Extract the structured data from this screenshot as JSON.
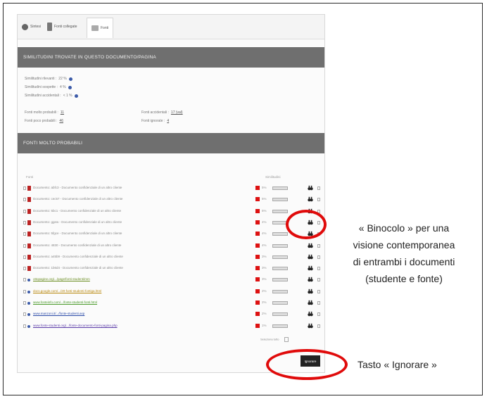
{
  "tabs": [
    {
      "label": "Sintesi",
      "icon": "globe-icon"
    },
    {
      "label": "Fonti collegate",
      "icon": "person-icon"
    },
    {
      "label": "Fonti",
      "icon": "document-icon"
    }
  ],
  "section_similarities": {
    "title": "SIMILITUDINI TROVATE IN QUESTO DOCUMENTO/PAGINA",
    "stats": [
      {
        "label": "Similitudini rilevanti :",
        "value": "22 %"
      },
      {
        "label": "Similitudini sospette :",
        "value": "4 %"
      },
      {
        "label": "Similitudini accidentali :",
        "value": "< 1 %"
      }
    ],
    "counts_left": [
      {
        "label": "Fonti molto probabili :",
        "value": "11"
      },
      {
        "label": "Fonti poco probabili :",
        "value": "46"
      }
    ],
    "counts_right": [
      {
        "label": "Fonti accidentali :",
        "value": "17 (val)"
      },
      {
        "label": "Fonti ignorate :",
        "value": "4"
      }
    ]
  },
  "section_sources": {
    "title": "FONTI MOLTO PROBABILI",
    "col_source": "Fonti",
    "col_similarity": "Similitudini",
    "rows": [
      {
        "n": "1",
        "text": "Documento: abfc3 - Documento confidenziale di un altro cliente",
        "pct": "5%",
        "web": false
      },
      {
        "n": "2",
        "text": "Documento: cec57 - Documento confidenziale di un altro cliente",
        "pct": "5%",
        "web": false
      },
      {
        "n": "3",
        "text": "Documento: 5bc1 - Documento confidenziale di un altro cliente",
        "pct": "5%",
        "web": false
      },
      {
        "n": "4",
        "text": "Documento: ggew - Documento confidenziale di un altro cliente",
        "pct": "4%",
        "web": false
      },
      {
        "n": "5",
        "text": "Documento: 5fgce - Documento confidenziale di un altro cliente",
        "pct": "4%",
        "web": false
      },
      {
        "n": "6",
        "text": "Documento: 4830 - Documento confidenziale di un altro cliente",
        "pct": "4%",
        "web": false
      },
      {
        "n": "7",
        "text": "Documento: a45b9 - Documento confidenziale di un altro cliente",
        "pct": "3%",
        "web": false
      },
      {
        "n": "8",
        "text": "Documento: 1b6d4 - Documento confidenziale di un altro cliente",
        "pct": "3%",
        "web": false
      },
      {
        "n": "9",
        "text": "ottopagine.org/.../page/fonti-studenti/mm",
        "pct": "3%",
        "web": true,
        "link_color": "#6b8e23"
      },
      {
        "n": "10",
        "text": "docs.google.com/.../20-fonti-studenti-fontiga.html",
        "pct": "2%",
        "web": true,
        "link_color": "#b8860b"
      },
      {
        "n": "11",
        "text": "www.fonteinfo.com/.../fonte-studenti-fonti.html",
        "pct": "2%",
        "web": true,
        "link_color": "#4a9a2a"
      },
      {
        "n": "12",
        "text": "www.manzoni.it/.../fonte-studenti.asp",
        "pct": "2%",
        "web": true,
        "link_color": "#2a4aa8"
      },
      {
        "n": "13",
        "text": "www.fonte-studenti.org/.../fonte-documento-fonti-pagina.php",
        "pct": "1%",
        "web": true,
        "link_color": "#5a3aa8"
      }
    ],
    "select_all": "Seleziona tutto",
    "ignore_button": "Ignorare"
  },
  "annotations": {
    "binocular_lines": [
      "« Binocolo  » per una",
      "visione contemporanea",
      "di entrambi  i documenti",
      "(studente  e fonte)"
    ],
    "ignore": "Tasto « Ignorare »"
  },
  "colors": {
    "highlight": "#e00b0b",
    "header_bar": "#6f6f6f",
    "info_icon": "#3b5aa8"
  }
}
